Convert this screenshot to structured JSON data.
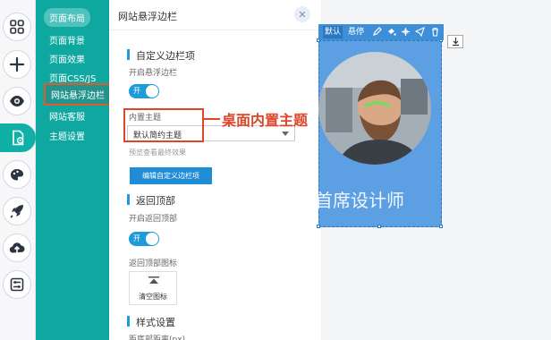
{
  "rail": {
    "items": [
      {
        "icon": "grid-icon",
        "active": false
      },
      {
        "icon": "plus-icon",
        "active": false
      },
      {
        "icon": "eye-icon",
        "active": false
      },
      {
        "icon": "document-settings-icon",
        "active": true
      },
      {
        "icon": "palette-icon",
        "active": false
      },
      {
        "icon": "rocket-icon",
        "active": false
      },
      {
        "icon": "cloud-upload-icon",
        "active": false
      },
      {
        "icon": "sliders-icon",
        "active": false
      }
    ]
  },
  "submenu": {
    "head": "页面布局",
    "items": [
      "页面背景",
      "页面效果",
      "页面CSS/JS",
      "网站悬浮边栏",
      "网站客服",
      "主题设置"
    ],
    "current": "网站悬浮边栏"
  },
  "panel": {
    "title": "网站悬浮边栏",
    "close_icon": "close-icon",
    "section_custom": "自定义边栏项",
    "enable_sidebar_label": "开启悬浮边栏",
    "toggle_on_text": "开",
    "builtin_theme_label": "内置主题",
    "theme_select_value": "默认简约主题",
    "preview_hint": "预览查看最终效果",
    "edit_button": "编辑自定义边栏项",
    "section_back_top": "返回顶部",
    "enable_back_top_label": "开启返回顶部",
    "back_top_icon_label": "返回顶部图标",
    "clear_icon_label": "清空图标",
    "section_style": "样式设置",
    "bottom_distance_label": "距底部距离(px)"
  },
  "callout": {
    "text": "桌面内置主题",
    "color": "#e0452a"
  },
  "canvas": {
    "toolbar": {
      "default_label": "默认",
      "hover_label": "悬停",
      "icons": [
        "edit-icon",
        "fill-icon",
        "move-icon",
        "send-icon",
        "trash-icon"
      ]
    },
    "download_icon": "download-icon",
    "designer_text": "首席设计师"
  },
  "colors": {
    "teal": "#0fa8a0",
    "accent_blue": "#1f9bd9",
    "button_blue": "#1f8dd6",
    "frame_blue": "#5d9fe3",
    "highlight_red": "#e05a2a"
  }
}
